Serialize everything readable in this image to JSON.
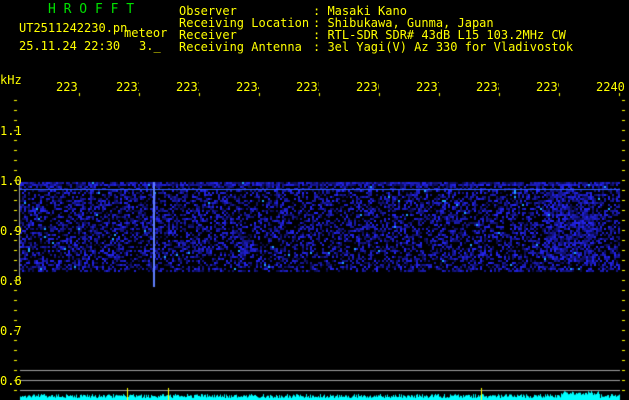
{
  "app_title": "H R O F F T",
  "file_name": "UT2511242230.pn",
  "mode_label": "meteor",
  "datetime": "25.11.24 22:30",
  "count_value": "3._",
  "info": [
    {
      "label": "Observer",
      "value": ": Masaki Kano"
    },
    {
      "label": "Receiving Location",
      "value": ": Shibukawa, Gunma, Japan"
    },
    {
      "label": "Receiver",
      "value": ": RTL-SDR SDR# 43dB L15 103.2MHz CW"
    },
    {
      "label": "Receiving Antenna",
      "value": ": 3el Yagi(V) Az 330 for Vladivostok"
    }
  ],
  "x_unit": "kHz",
  "x_ticks": [
    "2231",
    "2232",
    "2233",
    "2234",
    "2235",
    "2236",
    "2237",
    "2238",
    "2239",
    "2240"
  ],
  "y_ticks": [
    "1.1",
    "1.0",
    "0.9",
    "0.8",
    "0.7",
    "0.6"
  ],
  "colors": {
    "text": "#ffff00",
    "title": "#00e000",
    "signal": "#2020ff",
    "spectrum": "#00ffff",
    "grid": "#a0a0a0"
  }
}
